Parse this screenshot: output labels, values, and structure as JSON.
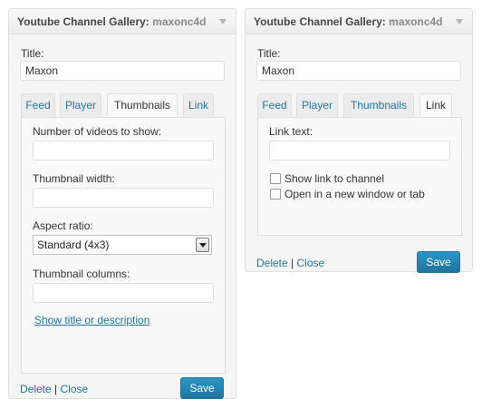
{
  "widgets": [
    {
      "title": "Youtube Channel Gallery:",
      "instance": "maxonc4d",
      "title_label": "Title:",
      "title_value": "Maxon",
      "tabs": [
        {
          "label": "Feed"
        },
        {
          "label": "Player"
        },
        {
          "label": "Thumbnails",
          "active": true
        },
        {
          "label": "Link"
        }
      ],
      "thumbnails": {
        "num_videos_label": "Number of videos to show:",
        "num_videos_value": "",
        "thumb_width_label": "Thumbnail width:",
        "thumb_width_value": "",
        "aspect_label": "Aspect ratio:",
        "aspect_value": "Standard (4x3)",
        "columns_label": "Thumbnail columns:",
        "columns_value": "",
        "show_title_link": "Show title or description"
      },
      "delete_label": "Delete",
      "separator": "|",
      "close_label": "Close",
      "save_label": "Save"
    },
    {
      "title": "Youtube Channel Gallery:",
      "instance": "maxonc4d",
      "title_label": "Title:",
      "title_value": "Maxon",
      "tabs": [
        {
          "label": "Feed"
        },
        {
          "label": "Player"
        },
        {
          "label": "Thumbnails"
        },
        {
          "label": "Link",
          "active": true
        }
      ],
      "link": {
        "link_text_label": "Link text:",
        "link_text_value": "",
        "show_link_label": "Show link to channel",
        "show_link_checked": false,
        "new_window_label": "Open in a new window or tab",
        "new_window_checked": false
      },
      "delete_label": "Delete",
      "separator": "|",
      "close_label": "Close",
      "save_label": "Save"
    }
  ],
  "colors": {
    "link": "#21759b",
    "button": "#21759b",
    "border": "#dfdfdf"
  }
}
